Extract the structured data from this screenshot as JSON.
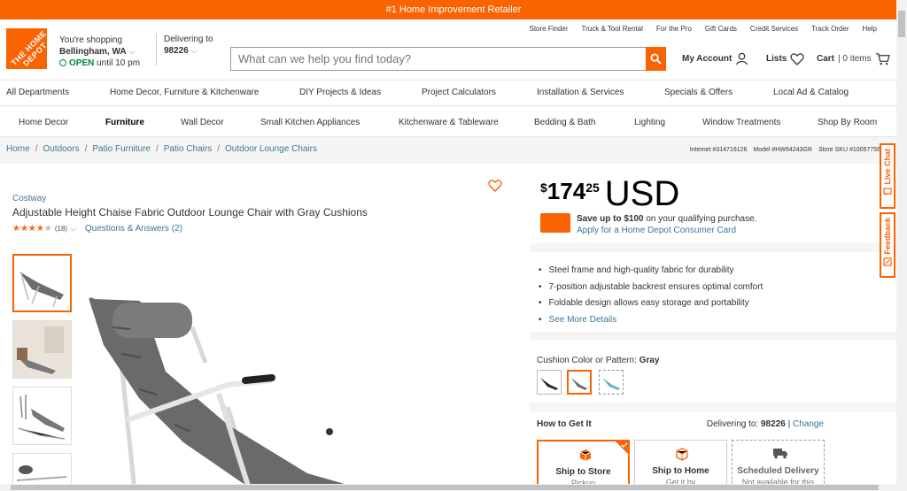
{
  "promo": "#1 Home Improvement Retailer",
  "logo_text": "THE HOME DEPOT",
  "store": {
    "label": "You're shopping",
    "city": "Bellingham, WA",
    "status": "OPEN",
    "hours": "until 10 pm"
  },
  "delivery": {
    "label": "Delivering to",
    "zip": "98226"
  },
  "utility_links": [
    "Store Finder",
    "Truck & Tool Rental",
    "For the Pro",
    "Gift Cards",
    "Credit Services",
    "Track Order",
    "Help"
  ],
  "search": {
    "placeholder": "What can we help you find today?"
  },
  "account": {
    "my_account": "My Account",
    "lists": "Lists",
    "cart": "Cart",
    "cart_items": "| 0 items"
  },
  "nav_primary": [
    "All Departments",
    "Home Decor, Furniture & Kitchenware",
    "DIY Projects & Ideas",
    "Project Calculators",
    "Installation & Services",
    "Specials & Offers",
    "Local Ad & Catalog"
  ],
  "nav_secondary": [
    "Home Decor",
    "Furniture",
    "Wall Decor",
    "Small Kitchen Appliances",
    "Kitchenware & Tableware",
    "Bedding & Bath",
    "Lighting",
    "Window Treatments",
    "Shop By Room"
  ],
  "breadcrumb": [
    "Home",
    "Outdoors",
    "Patio Furniture",
    "Patio Chairs",
    "Outdoor Lounge Chairs"
  ],
  "ids": {
    "internet": "Internet #314716126",
    "model": "Model #HW64243GR",
    "sku": "Store SKU #10057756"
  },
  "product": {
    "brand": "Costway",
    "title": "Adjustable Height Chaise Fabric Outdoor Lounge Chair with Gray Cushions",
    "rating": 4,
    "review_count": "(18)",
    "qa": "Questions & Answers (2)"
  },
  "price": {
    "currency": "$",
    "dollars": "174",
    "cents": "25",
    "unit": "USD"
  },
  "credit": {
    "offer_bold": "Save up to $100",
    "offer_rest": " on your qualifying purchase.",
    "apply": "Apply for a Home Depot Consumer Card"
  },
  "bullets": [
    "Steel frame and high-quality fabric for durability",
    "7-position adjustable backrest ensures optimal comfort",
    "Foldable design allows easy storage and portability"
  ],
  "see_more": "See More Details",
  "color": {
    "label": "Cushion Color or Pattern:",
    "value": "Gray"
  },
  "get_it": {
    "title": "How to Get It",
    "delivering_label": "Delivering to:",
    "zip": "98226",
    "change": "Change",
    "options": [
      {
        "label": "Ship to Store",
        "sub": "Pickup"
      },
      {
        "label": "Ship to Home",
        "sub": "Get it by"
      },
      {
        "label": "Scheduled Delivery",
        "sub": "Not available for this"
      }
    ]
  },
  "side_tabs": {
    "chat": "Live Chat",
    "feedback": "Feedback"
  },
  "colors": {
    "brand": "#f96302",
    "link": "#3e7697"
  }
}
